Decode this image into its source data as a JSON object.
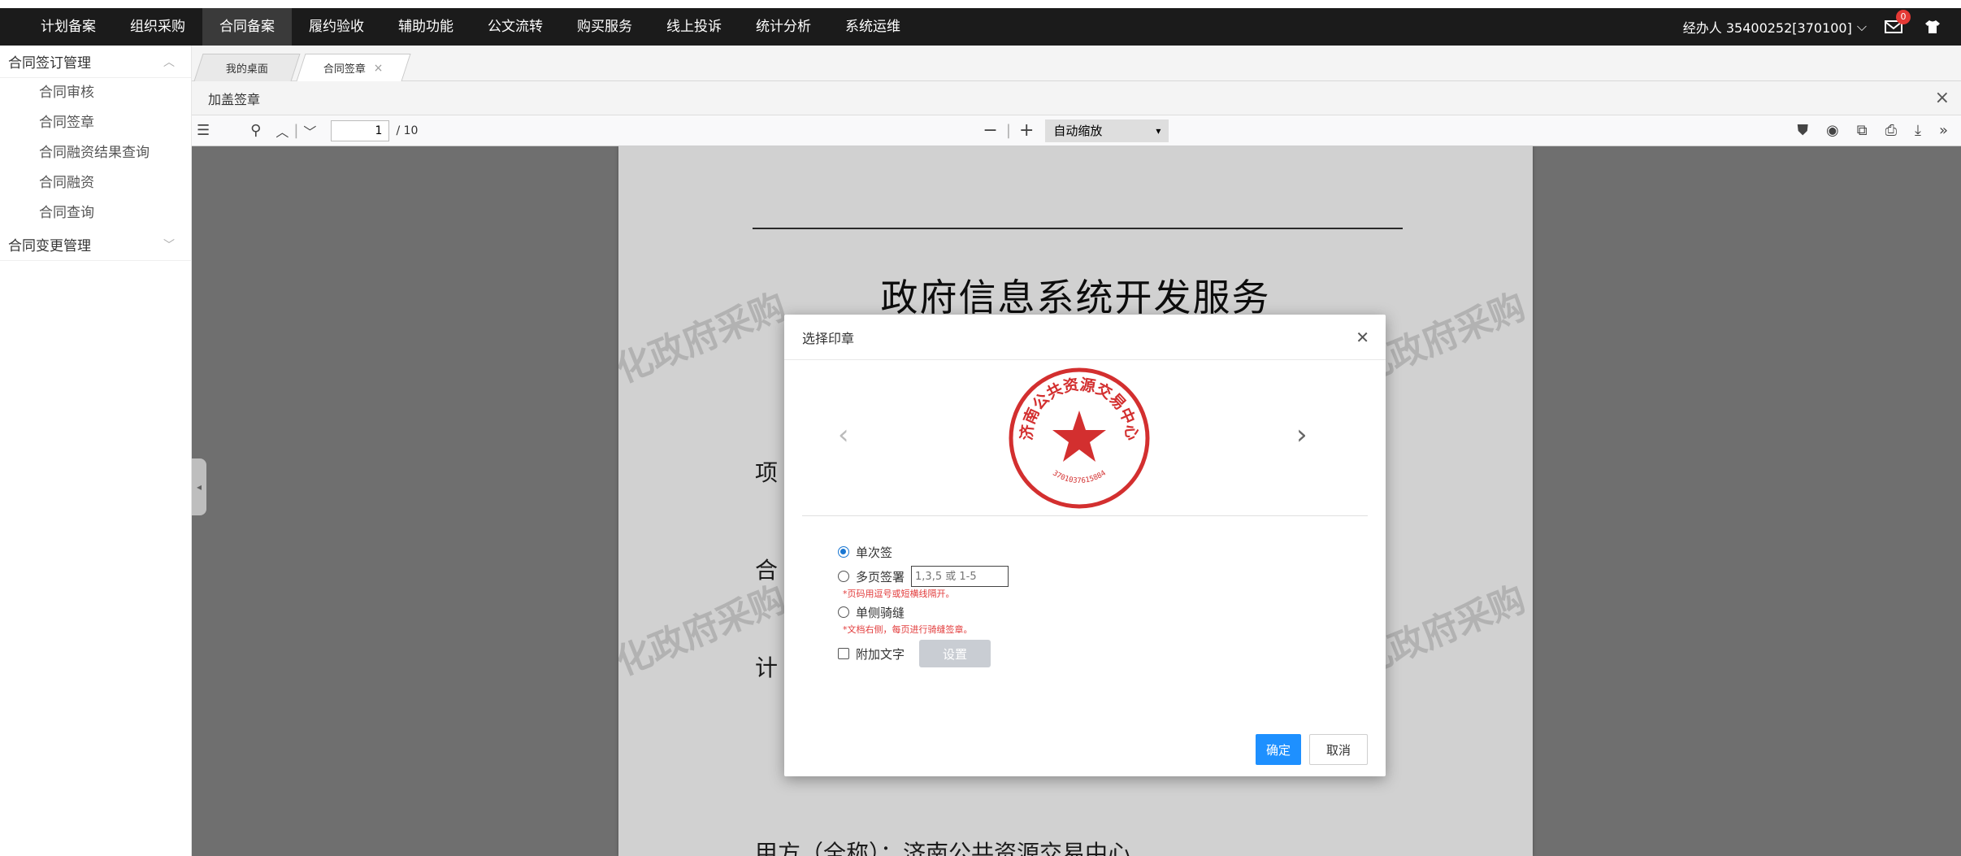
{
  "topnav": {
    "items": [
      "计划备案",
      "组织采购",
      "合同备案",
      "履约验收",
      "辅助功能",
      "公文流转",
      "购买服务",
      "线上投诉",
      "统计分析",
      "系统运维"
    ],
    "active_index": 2,
    "user_label": "经办人 35400252[370100]",
    "message_count": "0",
    "colors": {
      "bar": "#1b1b1b",
      "active": "#3a3a3a"
    }
  },
  "sidebar": {
    "group1": "合同签订管理",
    "items": [
      "合同审核",
      "合同签章",
      "合同融资结果查询",
      "合同融资",
      "合同查询"
    ],
    "group2": "合同变更管理"
  },
  "tabs": {
    "home": "我的桌面",
    "current": "合同签章"
  },
  "subheader": {
    "title": "加盖签章",
    "close": "×"
  },
  "pdf_toolbar": {
    "page": "1",
    "page_total": "/ 10",
    "zoom": "自动缩放"
  },
  "document": {
    "title": "政府信息系统开发服务",
    "partial_lines": [
      "项",
      "合",
      "计"
    ],
    "footer_line": "甲方（全称）：济南公共资源交易中心",
    "watermark": "化政府采购"
  },
  "modal": {
    "title": "选择印章",
    "seal": {
      "arc_text": "济南公共资源交易中心",
      "number": "3701037615884",
      "color": "#d32f2f"
    },
    "options": {
      "single": "单次签",
      "multi": "多页签署",
      "multi_placeholder": "1,3,5 或 1-5",
      "multi_hint": "*页码用逗号或短横线隔开。",
      "riding": "单侧骑缝",
      "riding_hint": "*文档右侧，每页进行骑缝签章。",
      "add_text": "附加文字",
      "settings": "设置"
    },
    "confirm": "确定",
    "cancel": "取消"
  }
}
